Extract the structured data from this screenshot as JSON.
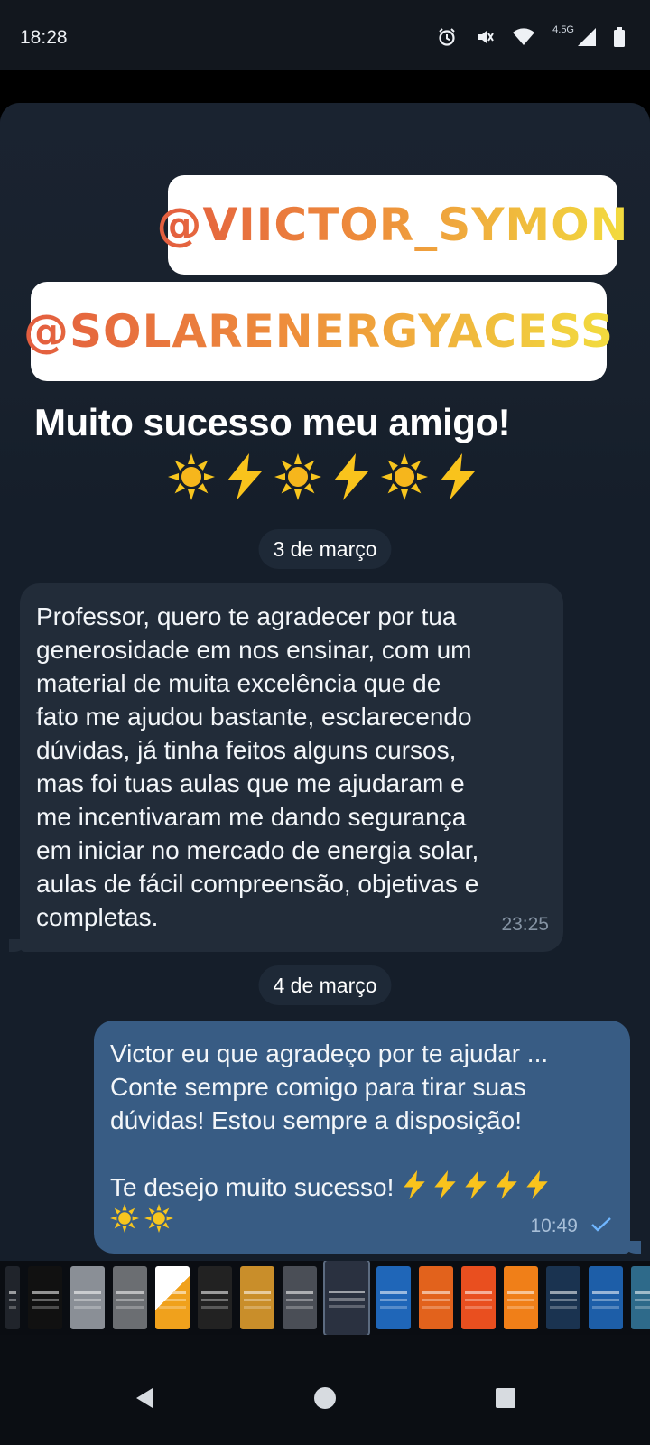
{
  "status_bar": {
    "time": "18:28",
    "network_label": "4.5G",
    "icons": [
      "alarm-icon",
      "vibrate-off-icon",
      "wifi-icon",
      "signal-icon",
      "battery-icon"
    ]
  },
  "story": {
    "mentions": [
      "@VIICTOR_SYMON",
      "@SOLARENERGYACESS"
    ],
    "caption": "Muito sucesso meu amigo!",
    "emojis": [
      "sun",
      "lightning",
      "sun",
      "lightning",
      "sun",
      "lightning"
    ]
  },
  "messages": [
    {
      "date": "3 de março",
      "direction": "incoming",
      "text": "Professor, quero te agradecer por tua\ngenerosidade em nos ensinar, com um\nmaterial de muita excelência que de\nfato me ajudou bastante, esclarecendo\ndúvidas, já tinha feitos alguns cursos,\nmas foi tuas aulas que me ajudaram e\nme incentivaram me dando segurança\nem iniciar no mercado de energia solar,\naulas de fácil compreensão, objetivas e\ncompletas.",
      "time": "23:25"
    },
    {
      "date": "4 de março",
      "direction": "outgoing",
      "text": "Victor eu que agradeço por te ajudar ...\nConte sempre comigo para tirar suas\ndúvidas! Estou sempre a disposição!\n\nTe desejo muito sucesso!",
      "emoji_line_1": [
        "lightning",
        "lightning",
        "lightning",
        "lightning",
        "lightning"
      ],
      "emoji_line_2": [
        "sun",
        "sun"
      ],
      "time": "10:49",
      "status": "read"
    }
  ],
  "colors": {
    "chat_background": "#151e2a",
    "incoming_bubble": "#222c39",
    "outgoing_bubble": "#385c84",
    "mention_gradient_start": "#e35d3f",
    "mention_gradient_end": "#f2dc3e"
  },
  "thumbnail_strip": {
    "count": 17,
    "selected_index": 7
  },
  "nav_bar": {
    "icons": [
      "back-icon",
      "home-icon",
      "recents-icon"
    ]
  }
}
